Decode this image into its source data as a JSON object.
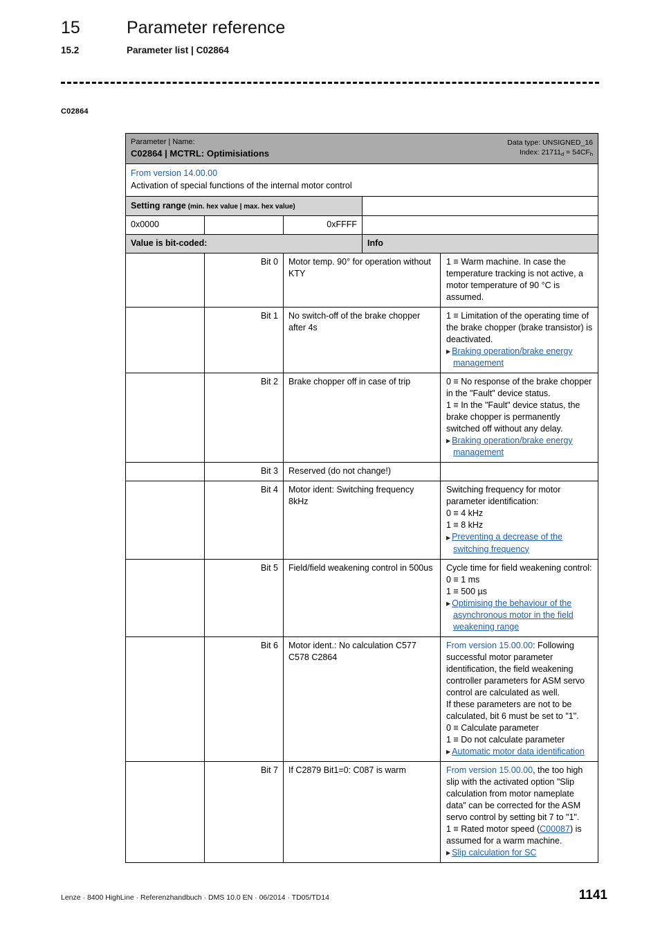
{
  "header": {
    "chapter_number": "15",
    "chapter_title": "Parameter reference",
    "section_number": "15.2",
    "section_title": "Parameter list | C02864"
  },
  "param_tag": "C02864",
  "colors": {
    "link": "#1f5fa9",
    "title_bar_bg": "#ababab",
    "section_header_bg": "#d4d4d4"
  },
  "table": {
    "title_bar": {
      "small_label": "Parameter | Name:",
      "title": "C02864 | MCTRL: Optimisiations",
      "data_type_label": "Data type: UNSIGNED_16",
      "index_prefix": "Index: ",
      "index_dec": "21711",
      "index_dec_sub": "d",
      "index_eq": " = ",
      "index_hex": "54CF",
      "index_hex_sub": "h"
    },
    "description": {
      "version": "From version 14.00.00",
      "text": "Activation of special functions of the internal motor control"
    },
    "setting_range": {
      "header_bold": "Setting range",
      "header_small": " (min. hex value | max. hex value)",
      "min_value": "0x0000",
      "mid_value": "",
      "max_value": "0xFFFF"
    },
    "bitcoded_header": {
      "left": "Value is bit-coded:",
      "right": "Info"
    },
    "bits": [
      {
        "bit": "Bit 0",
        "name": "Motor temp. 90° for operation without KTY",
        "info_lines": [
          {
            "type": "text",
            "text": "1 ≡ Warm machine. In case the temperature tracking is not active, a motor temperature of 90 °C is assumed."
          }
        ]
      },
      {
        "bit": "Bit 1",
        "name": "No switch-off of the brake chopper after 4s",
        "info_lines": [
          {
            "type": "text",
            "text": "1 ≡ Limitation of the operating time of the brake chopper (brake transistor) is deactivated."
          },
          {
            "type": "link",
            "text": "Braking operation/brake energy management"
          }
        ]
      },
      {
        "bit": "Bit 2",
        "name": "Brake chopper off in case of trip",
        "info_lines": [
          {
            "type": "text",
            "text": "0 ≡ No response of the brake chopper in the \"Fault\" device status."
          },
          {
            "type": "text",
            "text": "1 ≡ In the \"Fault\" device status, the brake chopper is permanently switched off without any delay."
          },
          {
            "type": "link",
            "text": "Braking operation/brake energy management"
          }
        ]
      },
      {
        "bit": "Bit 3",
        "name": "Reserved (do not change!)",
        "info_lines": []
      },
      {
        "bit": "Bit 4",
        "name": "Motor ident: Switching frequency 8kHz",
        "info_lines": [
          {
            "type": "text",
            "text": "Switching frequency for motor parameter identification:"
          },
          {
            "type": "text",
            "text": "0 ≡ 4 kHz"
          },
          {
            "type": "text",
            "text": "1 ≡ 8 kHz"
          },
          {
            "type": "link",
            "text": "Preventing a decrease of the switching frequency"
          }
        ]
      },
      {
        "bit": "Bit 5",
        "name": "Field/field weakening control in 500us",
        "info_lines": [
          {
            "type": "text",
            "text": "Cycle time for field weakening control:"
          },
          {
            "type": "text",
            "text": "0 ≡ 1 ms"
          },
          {
            "type": "text",
            "text": "1 ≡ 500 µs"
          },
          {
            "type": "link",
            "text": "Optimising the behaviour of the asynchronous motor in the field weakening range"
          }
        ]
      },
      {
        "bit": "Bit 6",
        "name": "Motor ident.: No calculation C577 C578 C2864",
        "info_lines": [
          {
            "type": "version_text",
            "version": "From version 15.00.00",
            "text": ": Following successful motor parameter identification, the field weakening controller parameters for ASM servo control are calculated as well."
          },
          {
            "type": "text",
            "text": "If these parameters are not to be calculated, bit 6 must be set to \"1\"."
          },
          {
            "type": "text",
            "text": "0 ≡ Calculate parameter"
          },
          {
            "type": "text",
            "text": "1 ≡ Do not calculate parameter"
          },
          {
            "type": "link",
            "text": "Automatic motor data identification"
          }
        ]
      },
      {
        "bit": "Bit 7",
        "name": "If C2879 Bit1=0: C087 is warm",
        "info_lines": [
          {
            "type": "version_text",
            "version": "From version 15.00.00",
            "text": ", the too high slip with the activated option \"Slip calculation from motor nameplate data\" can be corrected for the ASM servo control by setting bit 7 to \"1\"."
          },
          {
            "type": "inline_link_text",
            "before": "1 ≡ Rated motor speed (",
            "link": "C00087",
            "after": ") is assumed for a warm machine."
          },
          {
            "type": "link",
            "text": "Slip calculation for SC"
          }
        ]
      }
    ]
  },
  "footer": {
    "text": "Lenze · 8400 HighLine · Referenzhandbuch · DMS 10.0 EN · 06/2014 · TD05/TD14",
    "page_number": "1141"
  }
}
